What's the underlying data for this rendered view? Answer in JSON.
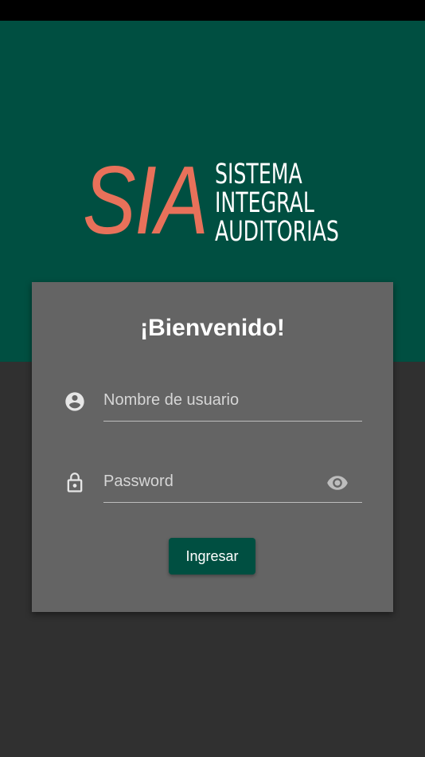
{
  "logo": {
    "mark": "SIA",
    "lines": [
      "SISTEMA",
      "INTEGRAL",
      "AUDITORIAS"
    ]
  },
  "login": {
    "title": "¡Bienvenido!",
    "username_placeholder": "Nombre de usuario",
    "password_placeholder": "Password",
    "submit_label": "Ingresar"
  },
  "icons": {
    "user": "account-circle-icon",
    "lock": "lock-icon",
    "toggle": "eye-icon"
  },
  "colors": {
    "primary": "#004f41",
    "accent": "#e8715a",
    "card": "#646464",
    "background": "#303030"
  }
}
